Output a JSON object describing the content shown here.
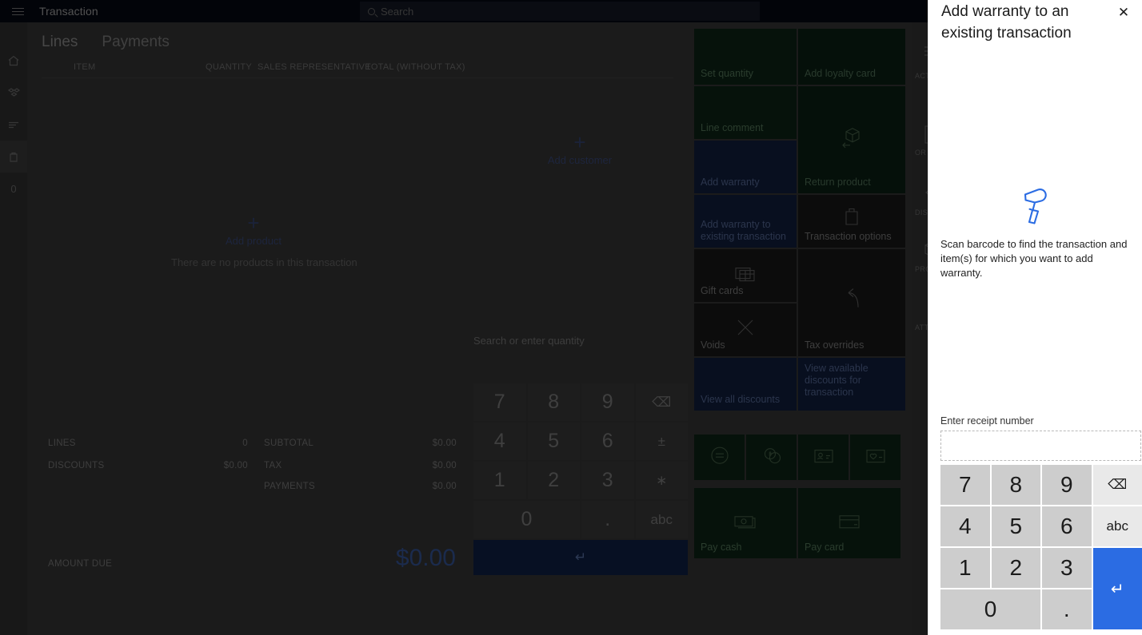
{
  "topbar": {
    "menu_icon": "hamburger-icon",
    "title": "Transaction",
    "search_placeholder": "Search",
    "search_icon": "search-icon"
  },
  "rail": {
    "items": [
      {
        "icon": "home-icon",
        "label": ""
      },
      {
        "icon": "products-icon",
        "label": ""
      },
      {
        "icon": "list-icon",
        "label": ""
      },
      {
        "icon": "cart-icon",
        "label": ""
      },
      {
        "icon": "",
        "label": "0"
      }
    ]
  },
  "tabs": [
    {
      "label": "Lines",
      "active": true
    },
    {
      "label": "Payments",
      "active": false
    }
  ],
  "grid": {
    "columns": [
      "ITEM",
      "QUANTITY",
      "SALES REPRESENTATIVE",
      "TOTAL (WITHOUT TAX)"
    ],
    "empty_message": "There are no products in this transaction",
    "add_product_label": "Add product",
    "add_customer_label": "Add customer",
    "plus_icon": "plus-icon"
  },
  "totals": {
    "lines_label": "LINES",
    "lines_value": "0",
    "discounts_label": "DISCOUNTS",
    "discounts_value": "$0.00",
    "subtotal_label": "SUBTOTAL",
    "subtotal_value": "$0.00",
    "tax_label": "TAX",
    "tax_value": "$0.00",
    "payments_label": "PAYMENTS",
    "payments_value": "$0.00",
    "amount_due_label": "AMOUNT DUE",
    "amount_due_value": "$0.00"
  },
  "main_keypad": {
    "hint": "Search or enter quantity",
    "keys": [
      "7",
      "8",
      "9",
      "⌫",
      "4",
      "5",
      "6",
      "±",
      "1",
      "2",
      "3",
      "∗",
      "0",
      ".",
      "abc"
    ],
    "enter_label": "↵"
  },
  "tiles": [
    {
      "label": "Set quantity",
      "color": "green",
      "icon": ""
    },
    {
      "label": "Add loyalty card",
      "color": "green2",
      "icon": ""
    },
    {
      "label": "Line comment",
      "color": "green",
      "icon": ""
    },
    {
      "label": "Return product",
      "color": "green2",
      "icon": "return-box-icon"
    },
    {
      "label": "Add warranty",
      "color": "navy",
      "icon": ""
    },
    {
      "label": "Add warranty to existing transaction",
      "color": "navy",
      "icon": ""
    },
    {
      "label": "Transaction options",
      "color": "dark",
      "icon": "bag-icon"
    },
    {
      "label": "Gift cards",
      "color": "dark",
      "icon": "giftcard-icon"
    },
    {
      "label": "Tax overrides",
      "color": "dark",
      "icon": "undo-icon"
    },
    {
      "label": "Voids",
      "color": "dark",
      "icon": "x-icon"
    },
    {
      "label": "View all discounts",
      "color": "navy",
      "icon": ""
    },
    {
      "label": "View available discounts for transaction",
      "color": "navy",
      "icon": ""
    }
  ],
  "icon_tiles": [
    {
      "icon": "equals-circle-icon"
    },
    {
      "icon": "coins-icon"
    },
    {
      "icon": "id-card-icon"
    },
    {
      "icon": "loyalty-card-icon"
    }
  ],
  "pay_tiles": [
    {
      "label": "Pay cash",
      "icon": "cash-icon"
    },
    {
      "label": "Pay card",
      "icon": "credit-card-icon"
    }
  ],
  "edge_panel": {
    "menu_icon": "hamburger-icon",
    "items": [
      {
        "label": "ACT",
        "icon": ""
      },
      {
        "label": "OR",
        "icon": "order-icon"
      },
      {
        "label": "DISC",
        "icon": "chevron-left-icon"
      },
      {
        "label": "PRO",
        "icon": "cube-icon"
      },
      {
        "label": "ATTR",
        "icon": ""
      }
    ]
  },
  "panel": {
    "title": "Add warranty to an existing transaction",
    "close_icon": "close-icon",
    "scanner_icon": "barcode-scanner-icon",
    "instruction": "Scan barcode to find the transaction and item(s) for which you want to add warranty.",
    "input_label": "Enter receipt number",
    "input_value": "",
    "input_placeholder": "",
    "keypad": {
      "keys": [
        "7",
        "8",
        "9",
        "4",
        "5",
        "6",
        "1",
        "2",
        "3",
        "0",
        "."
      ],
      "backspace_label": "⌫",
      "abc_label": "abc",
      "enter_label": "↵"
    },
    "accent_color": "#2b6ce3"
  }
}
